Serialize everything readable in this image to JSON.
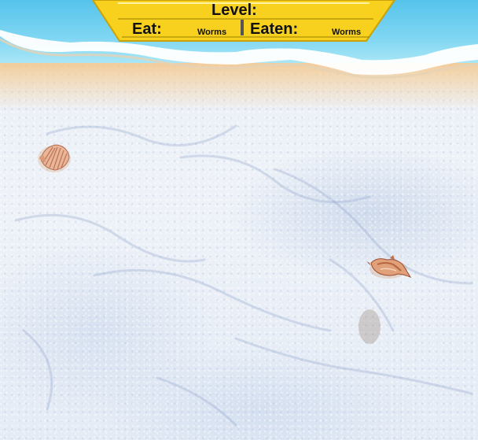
{
  "hud": {
    "level_label": "Level:",
    "eat_label": "Eat:",
    "eat_unit": "Worms",
    "eaten_label": "Eaten:",
    "eaten_unit": "Worms"
  },
  "colors": {
    "hud_panel": "#f7d11e",
    "hud_border": "#c9a20a",
    "sea": "#56c3ec",
    "sand": "#eaeff7"
  },
  "objects": [
    "scallop-shell",
    "conch-shell"
  ]
}
